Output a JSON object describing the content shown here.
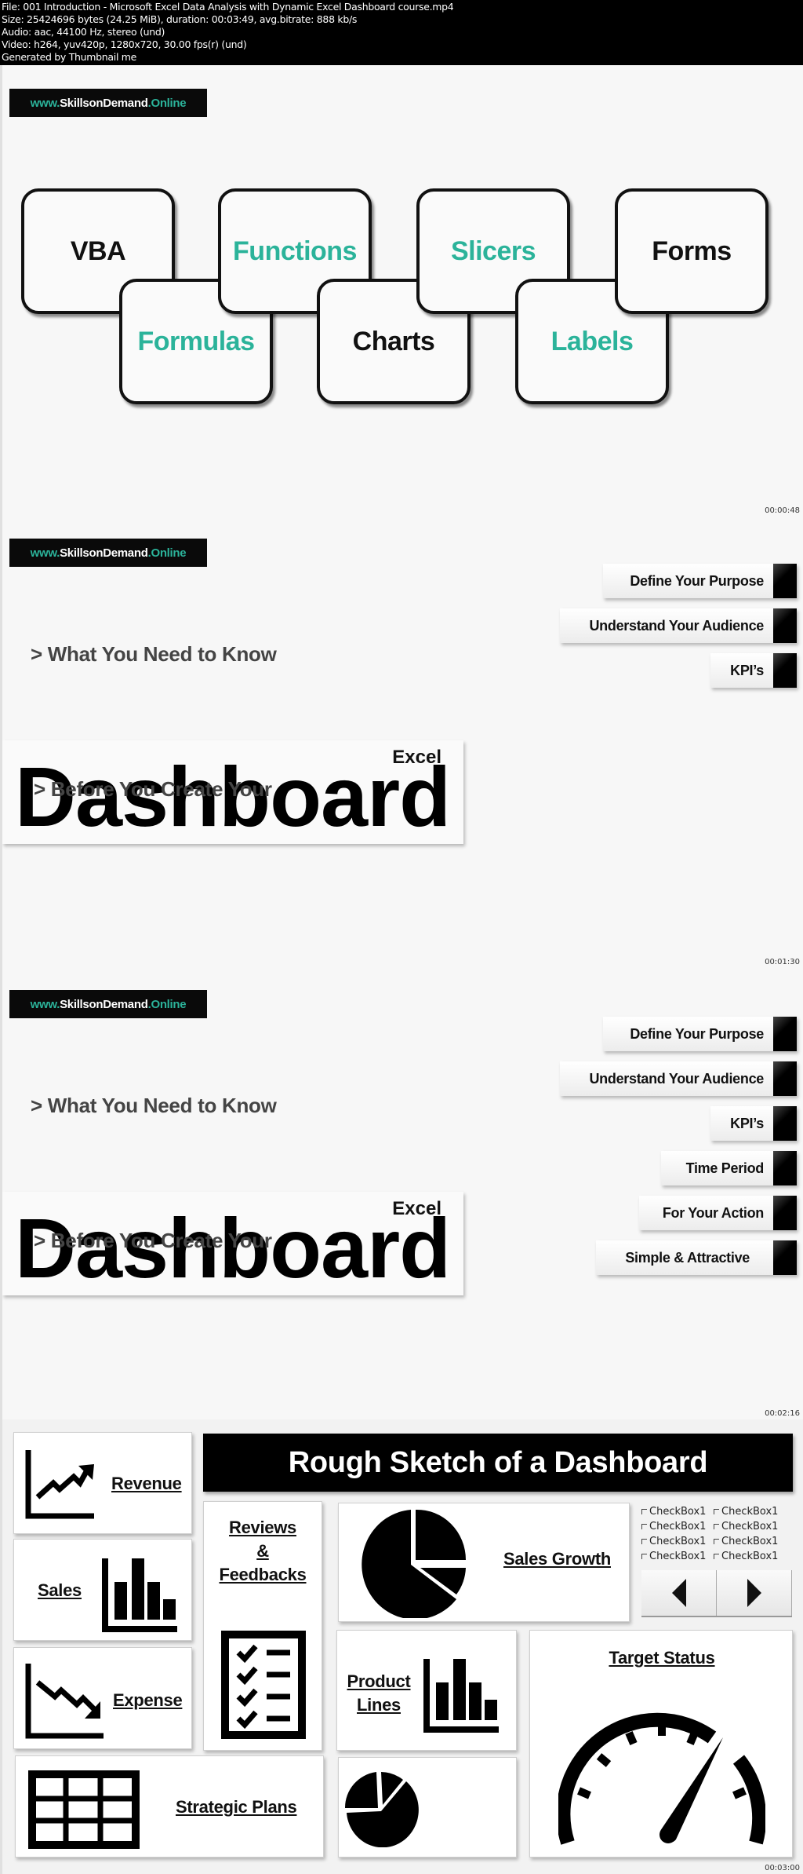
{
  "header": {
    "lines": [
      "File: 001 Introduction - Microsoft Excel Data Analysis with Dynamic Excel Dashboard course.mp4",
      "Size: 25424696 bytes (24.25 MiB), duration: 00:03:49, avg.bitrate: 888 kb/s",
      "Audio: aac, 44100 Hz, stereo (und)",
      "Video: h264, yuv420p, 1280x720, 30.00 fps(r) (und)",
      "Generated by Thumbnail me"
    ]
  },
  "brand": {
    "prefix": "www.",
    "name": "SkillsonDemand",
    "suffix": ".Online",
    "accent": "#2bb39a"
  },
  "frames": [
    {
      "timestamp": "00:00:48",
      "tiles": [
        {
          "label": "VBA",
          "color": "black"
        },
        {
          "label": "Functions",
          "color": "teal"
        },
        {
          "label": "Slicers",
          "color": "teal"
        },
        {
          "label": "Forms",
          "color": "black"
        },
        {
          "label": "Formulas",
          "color": "teal"
        },
        {
          "label": "Charts",
          "color": "black"
        },
        {
          "label": "Labels",
          "color": "teal"
        }
      ]
    },
    {
      "timestamp": "00:01:30",
      "what_label": "> What You Need to Know",
      "excel_label": "Excel",
      "dashboard_label": "Dashboard",
      "before_label": "> Before You Create Your",
      "steps": [
        "Define Your Purpose",
        "Understand Your Audience",
        "KPI’s"
      ]
    },
    {
      "timestamp": "00:02:16",
      "what_label": "> What You Need to Know",
      "excel_label": "Excel",
      "dashboard_label": "Dashboard",
      "before_label": "> Before You Create Your",
      "steps": [
        "Define Your Purpose",
        "Understand Your Audience",
        "KPI’s",
        "Time Period",
        "For Your Action",
        "Simple & Attractive"
      ]
    },
    {
      "timestamp": "00:03:00",
      "title": "Rough Sketch of a Dashboard",
      "cards": {
        "revenue": "Revenue",
        "sales": "Sales",
        "expense": "Expense",
        "reviews_1": "Reviews",
        "reviews_2": "&",
        "reviews_3": "Feedbacks",
        "sales_growth": "Sales Growth",
        "product_1": "Product",
        "product_2": "Lines",
        "strategic": "Strategic Plans",
        "target": "Target Status"
      },
      "checkboxes": [
        "CheckBox1",
        "CheckBox1",
        "CheckBox1",
        "CheckBox1",
        "CheckBox1",
        "CheckBox1",
        "CheckBox1",
        "CheckBox1"
      ]
    }
  ]
}
